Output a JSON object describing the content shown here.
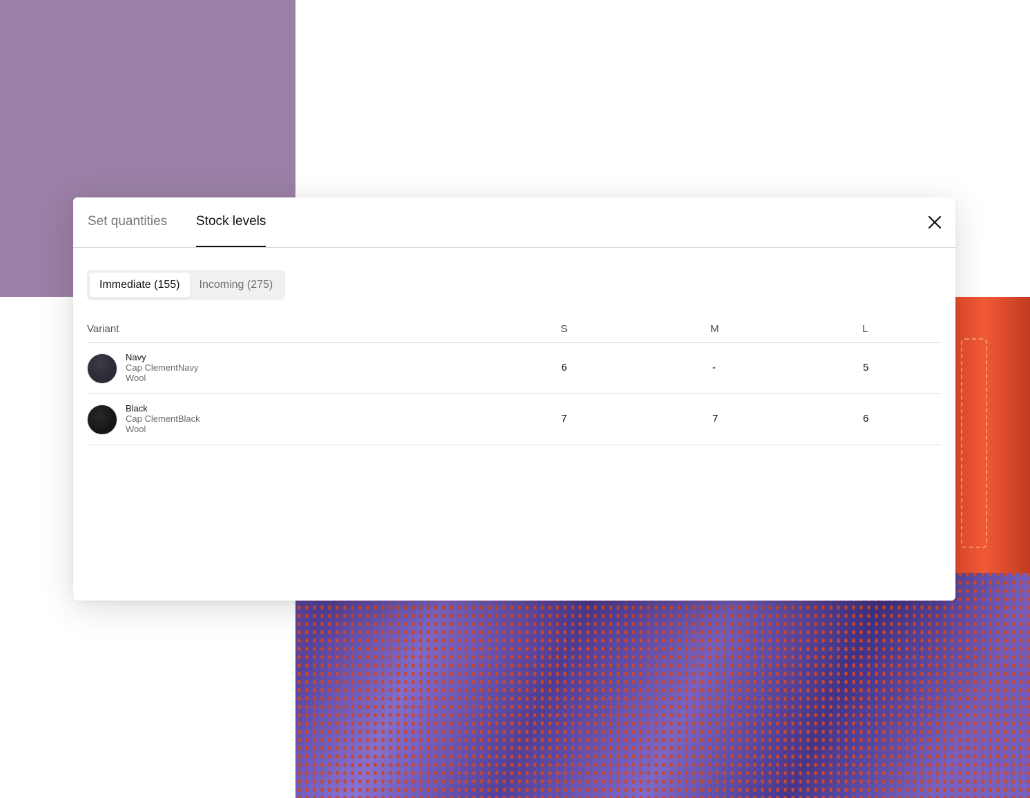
{
  "modal": {
    "tabs": [
      {
        "label": "Set quantities",
        "active": false
      },
      {
        "label": "Stock levels",
        "active": true
      }
    ],
    "close_icon": "close-icon"
  },
  "toggle": {
    "immediate": "Immediate (155)",
    "incoming": "Incoming (275)",
    "selected": "Immediate (155)"
  },
  "table": {
    "headers": [
      "Variant",
      "S",
      "M",
      "L"
    ],
    "rows": [
      {
        "color_name": "Navy",
        "product": "Cap ClementNavy",
        "material": "Wool",
        "swatch_color": "#2b2a36",
        "sizes": [
          "6",
          "-",
          "5"
        ]
      },
      {
        "color_name": "Black",
        "product": "Cap ClementBlack",
        "material": "Wool",
        "swatch_color": "#161616",
        "sizes": [
          "7",
          "7",
          "6"
        ]
      }
    ]
  },
  "colors": {
    "background_purple": "#9b7fa6",
    "photo_base": "#7c62c8",
    "accent_dots": "#c8482e",
    "bag": "#f05a35"
  }
}
